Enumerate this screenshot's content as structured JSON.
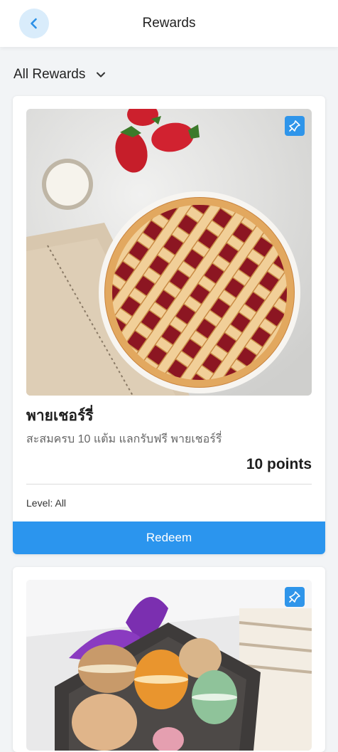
{
  "header": {
    "title": "Rewards",
    "back_icon": "chevron-left-icon"
  },
  "filter": {
    "label": "All Rewards",
    "icon": "chevron-down-icon"
  },
  "rewards": [
    {
      "title": "พายเชอร์รี่",
      "description": "สะสมครบ 10 แต้ม แลกรับฟรี พายเชอร์รี่",
      "points": "10 points",
      "level": "Level: All",
      "redeem_label": "Redeem",
      "image": "cherry-pie-photo",
      "pin_icon": "pin-icon"
    },
    {
      "image": "macarons-gift-box-photo",
      "pin_icon": "pin-icon"
    }
  ],
  "colors": {
    "accent": "#2b95ee",
    "back_button_bg": "#d9ecfb",
    "page_bg": "#f2f4f6"
  }
}
